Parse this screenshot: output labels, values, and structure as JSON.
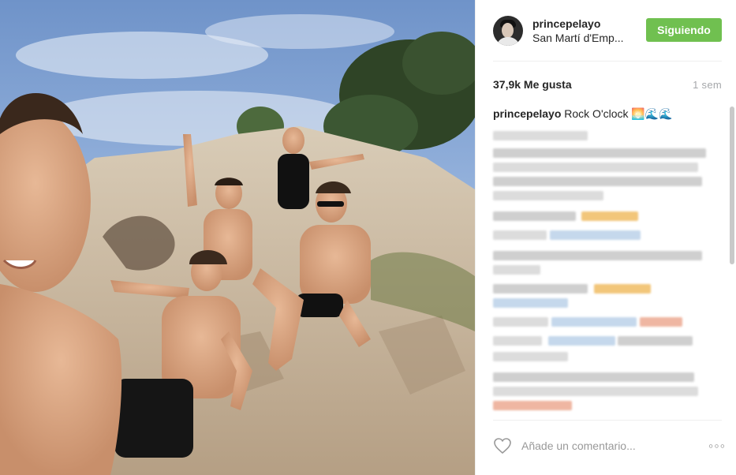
{
  "post": {
    "photo_alt": "",
    "username": "princepelayo",
    "location": "San Martí d'Emp...",
    "follow_label": "Siguiendo",
    "likes": "37,9k Me gusta",
    "time": "1 sem",
    "caption_user": "princepelayo",
    "caption_text": "Rock O'clock 🌅🌊🌊",
    "comment_placeholder": "Añade un comentario...",
    "more_label": "◦◦◦"
  },
  "colors": {
    "follow": "#70c050",
    "sky": "#8fb0db",
    "rock": "#c9b9a2"
  },
  "icons": [
    "heart-icon",
    "more-options-icon"
  ]
}
